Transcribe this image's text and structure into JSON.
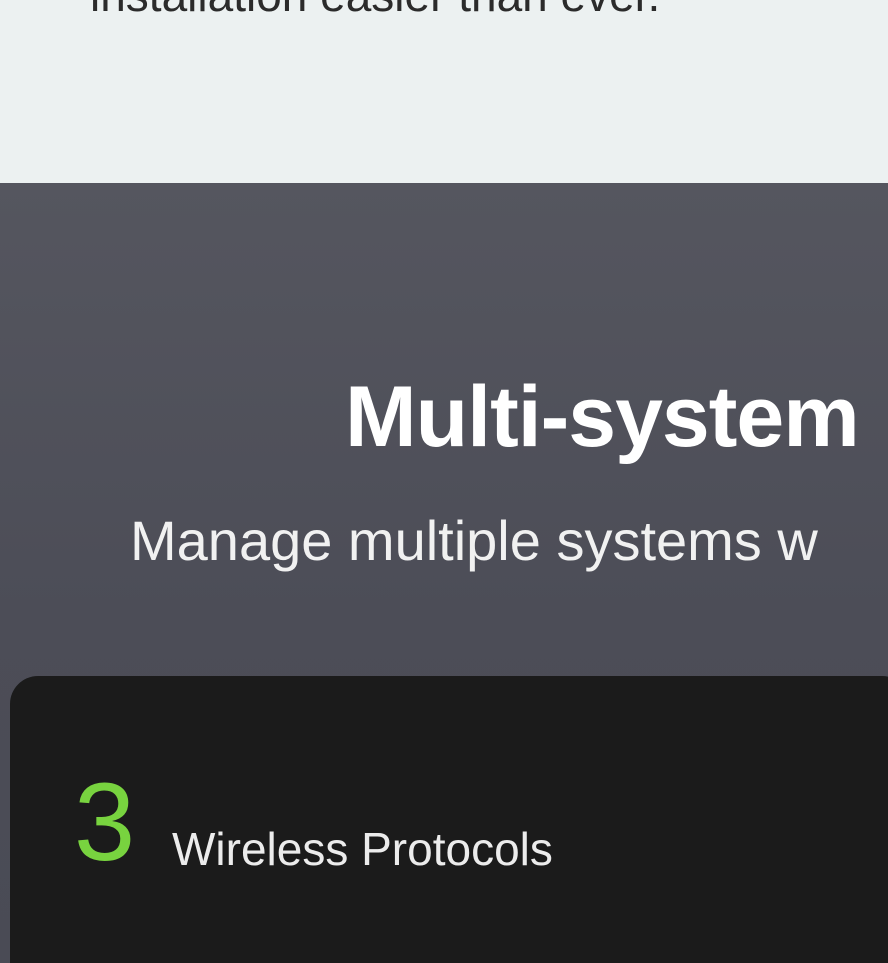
{
  "intro": {
    "partial_text": "installation easier than ever."
  },
  "multi_system": {
    "title": "Multi-system",
    "subtitle": "Manage multiple systems w"
  },
  "stat": {
    "number": "3",
    "label": "Wireless Protocols",
    "number_color": "#78d33f"
  },
  "colors": {
    "top_background": "#ecf1f1",
    "section_background": "#4f505a",
    "card_background": "#1b1b1b"
  }
}
